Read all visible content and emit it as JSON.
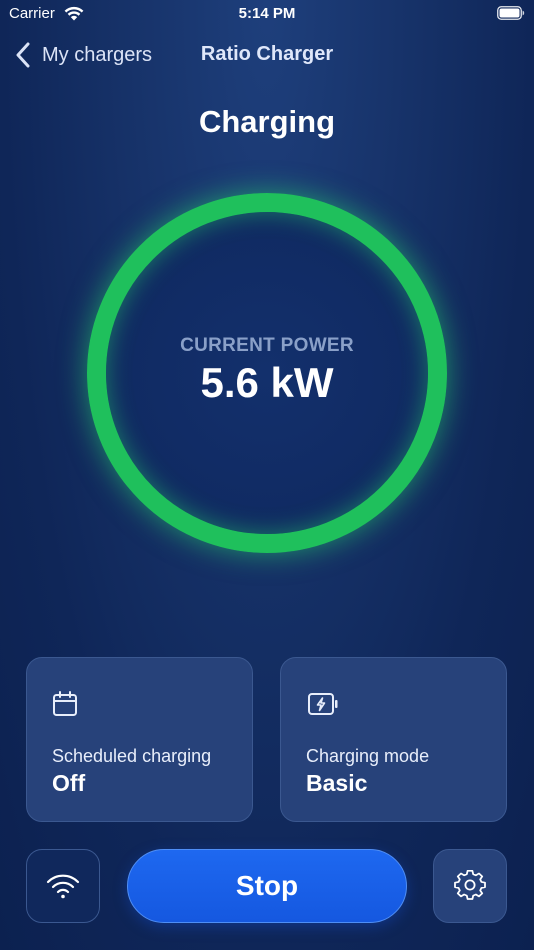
{
  "status_bar": {
    "carrier": "Carrier",
    "time": "5:14 PM",
    "icons": [
      "wifi-icon",
      "battery-icon"
    ]
  },
  "nav": {
    "back_label": "My chargers",
    "title": "Ratio Charger",
    "back_icon": "chevron-left-icon"
  },
  "charging": {
    "state": "Charging",
    "power_label": "CURRENT POWER",
    "power_value": "5.6 kW",
    "ring_color": "#1fc05c"
  },
  "cards": {
    "schedule": {
      "icon": "calendar-icon",
      "label": "Scheduled charging",
      "value": "Off"
    },
    "mode": {
      "icon": "battery-bolt-icon",
      "label": "Charging mode",
      "value": "Basic"
    }
  },
  "actions": {
    "wifi_icon": "wifi-icon",
    "stop_label": "Stop",
    "settings_icon": "gear-icon"
  },
  "colors": {
    "background": "#17336a",
    "card": "#27427a",
    "accent_blue": "#1e68f0",
    "ring_green": "#1fc05c"
  }
}
